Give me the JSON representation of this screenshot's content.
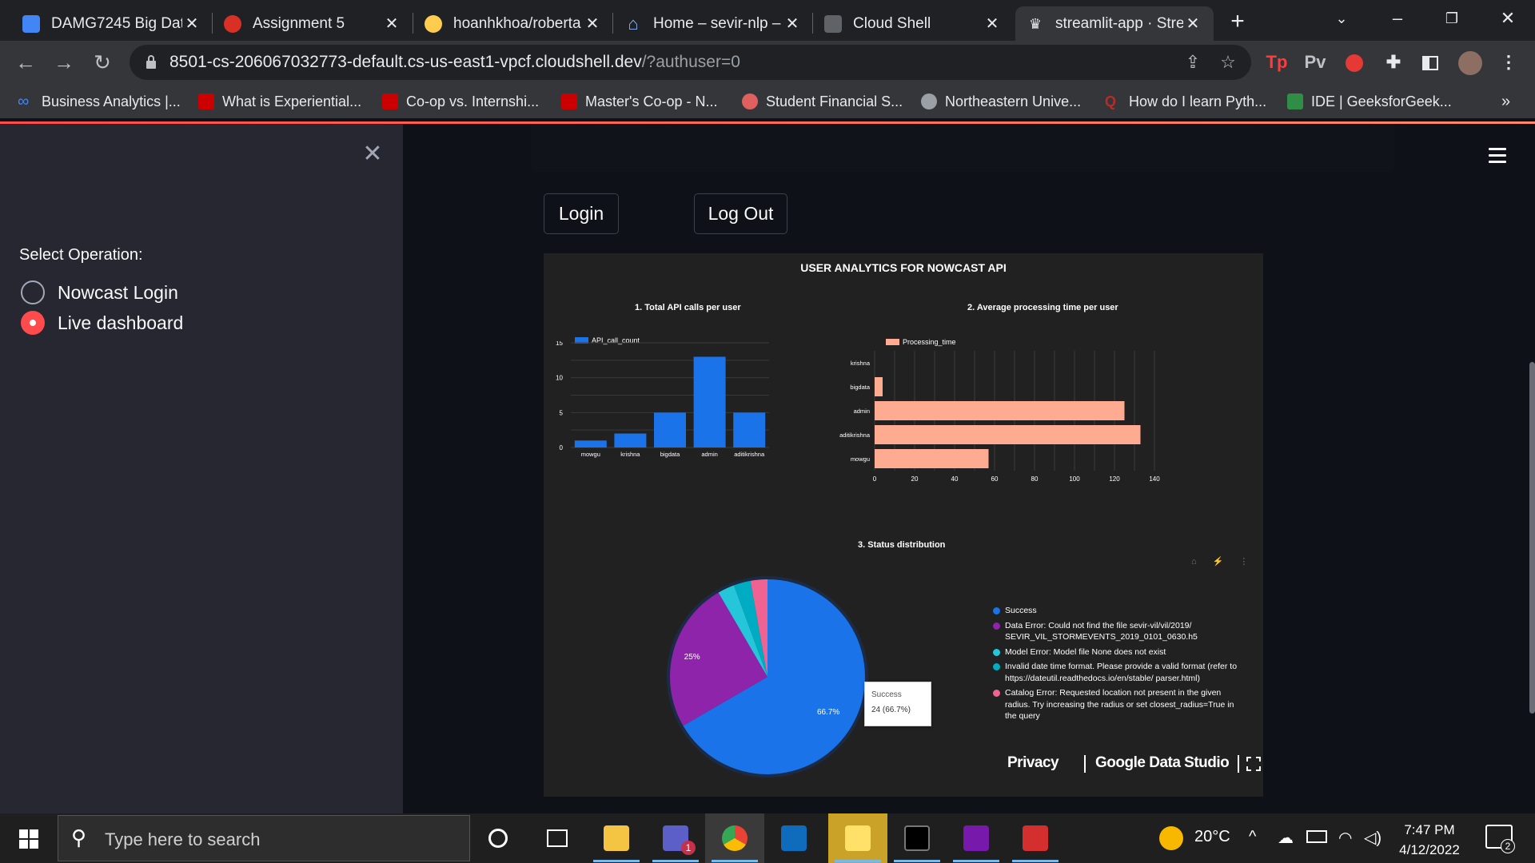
{
  "browser": {
    "tabs": [
      {
        "title": "DAMG7245 Big Dat",
        "icon_color": "#4285f4",
        "icon": "docs-icon"
      },
      {
        "title": "Assignment 5",
        "icon_color": "#d93025",
        "icon": "canvas-icon"
      },
      {
        "title": "hoanhkhoa/roberta",
        "icon_color": "#ffcc4d",
        "icon": "huggingface-icon"
      },
      {
        "title": "Home – sevir-nlp –",
        "icon_color": "#8ab4f8",
        "icon": "home-icon"
      },
      {
        "title": "Cloud Shell",
        "icon_color": "#9aa0a6",
        "icon": "terminal-icon"
      },
      {
        "title": "streamlit-app · Stre",
        "icon_color": "#ff4b4b",
        "icon": "streamlit-icon"
      }
    ],
    "url_main": "8501-cs-206067032773-default.cs-us-east1-vpcf.cloudshell.dev",
    "url_rest": "/?authuser=0",
    "extensions": [
      "Tp",
      "Pv"
    ],
    "bookmarks": [
      {
        "label": "Business Analytics |...",
        "color": "#4285f4"
      },
      {
        "label": "What is Experiential...",
        "color": "#cc0000"
      },
      {
        "label": "Co-op vs. Internshi...",
        "color": "#cc0000"
      },
      {
        "label": "Master's Co-op - N...",
        "color": "#cc0000"
      },
      {
        "label": "Student Financial S...",
        "color": "#e06060"
      },
      {
        "label": "Northeastern Unive...",
        "color": "#9aa0a6"
      },
      {
        "label": "How do I learn Pyth...",
        "color": "#b92b27"
      },
      {
        "label": "IDE | GeeksforGeek...",
        "color": "#2f8d46"
      }
    ],
    "bookmarks_more": "»"
  },
  "sidebar": {
    "label": "Select Operation:",
    "options": [
      {
        "label": "Nowcast Login",
        "selected": false
      },
      {
        "label": "Live dashboard",
        "selected": true
      }
    ]
  },
  "main": {
    "login_label": "Login",
    "logout_label": "Log Out"
  },
  "report": {
    "title": "USER ANALYTICS FOR NOWCAST API",
    "footer_privacy": "Privacy",
    "footer_brand": "Google Data Studio",
    "colors": {
      "bar": "#1a73e8",
      "hbar": "#ffab91",
      "success": "#1a73e8",
      "data_error": "#8e24aa",
      "model_error": "#26c6da",
      "date_error": "#00acc1",
      "catalog_error": "#f06292"
    }
  },
  "chart_data": [
    {
      "type": "bar",
      "title": "1. Total API calls per user",
      "legend": "API_call_count",
      "categories": [
        "mowgu",
        "krishna",
        "bigdata",
        "admin",
        "aditikrishna"
      ],
      "values": [
        1,
        2,
        5,
        13,
        5
      ],
      "ylim": [
        0,
        15
      ],
      "yticks": [
        0,
        5,
        10,
        15
      ],
      "grid": true
    },
    {
      "type": "bar",
      "orientation": "horizontal",
      "title": "2. Average processing time per user",
      "legend": "Processing_time",
      "categories": [
        "krishna",
        "bigdata",
        "admin",
        "aditikrishna",
        "mowgu"
      ],
      "values": [
        0,
        4,
        125,
        133,
        57
      ],
      "xlim": [
        0,
        140
      ],
      "xticks": [
        0,
        20,
        40,
        60,
        80,
        100,
        120,
        140
      ],
      "grid": true
    },
    {
      "type": "pie",
      "title": "3. Status distribution",
      "slices": [
        {
          "label": "Success",
          "value": 66.7
        },
        {
          "label": "Data Error: Could not find the file sevir-vil/vil/2019/ SEVIR_VIL_STORMEVENTS_2019_0101_0630.h5",
          "value": 25
        },
        {
          "label": "Model Error: Model file None does not exist",
          "value": 2.8
        },
        {
          "label": "Invalid date time format. Please provide a valid format (refer to https://dateutil.readthedocs.io/en/stable/ parser.html)",
          "value": 2.8
        },
        {
          "label": "Catalog Error: Requested location not present in the given radius. Try increasing the radius or set closest_radius=True in the query",
          "value": 2.8
        }
      ],
      "slice_labels": [
        "66.7%",
        "25%"
      ],
      "tooltip": {
        "title": "Success",
        "value": "24 (66.7%)"
      }
    }
  ],
  "taskbar": {
    "search_placeholder": "Type here to search",
    "temperature": "20°C",
    "time": "7:47 PM",
    "date": "4/12/2022",
    "notifications": "2",
    "teams_badge": "1"
  }
}
